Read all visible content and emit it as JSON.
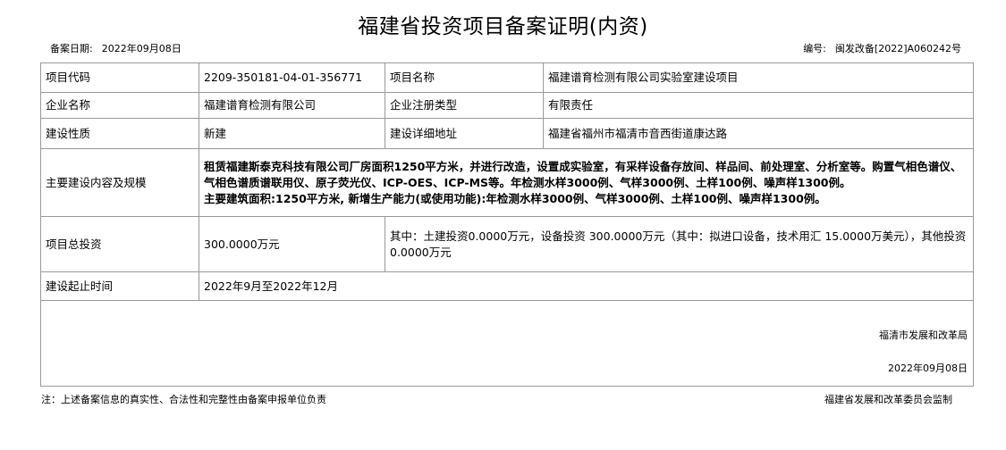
{
  "doc": {
    "title": "福建省投资项目备案证明(内资)",
    "filing_date_label": "备案日期:",
    "filing_date": "2022年09月08日",
    "number_label": "编号:",
    "number": "闽发改备[2022]A060242号"
  },
  "rows": {
    "project_code_label": "项目代码",
    "project_code": "2209-350181-04-01-356771",
    "project_name_label": "项目名称",
    "project_name": "福建谱育检测有限公司实验室建设项目",
    "company_label": "企业名称",
    "company": "福建谱育检测有限公司",
    "reg_type_label": "企业注册类型",
    "reg_type": "有限责任",
    "nature_label": "建设性质",
    "nature": "新建",
    "address_label": "建设详细地址",
    "address": "福建省福州市福清市音西街道康达路",
    "content_label": "主要建设内容及规模",
    "content_p1": "租赁福建斯泰克科技有限公司厂房面积1250平方米，并进行改造，设置成实验室，有采样设备存放间、样品间、前处理室、分析室等。购置气相色谱仪、气相色谱质谱联用仪、原子荧光仪、ICP-OES、ICP-MS等。年检测水样3000例、气样3000例、土样100例、噪声样1300例。",
    "content_p2": "主要建筑面积:1250平方米, 新增生产能力(或使用功能):年检测水样3000例、气样3000例、土样100例、噪声样1300例。",
    "investment_label": "项目总投资",
    "investment": "300.0000万元",
    "investment_detail": "其中：土建投资0.0000万元，设备投资 300.0000万元（其中：拟进口设备，技术用汇 15.0000万美元），其他投资 0.0000万元",
    "period_label": "建设起止时间",
    "period": "2022年9月至2022年12月"
  },
  "sign": {
    "org": "福清市发展和改革局",
    "date": "2022年09月08日"
  },
  "footer": {
    "note": "注：上述备案信息的真实性、合法性和完整性由备案申报单位负责",
    "supervisor": "福建省发展和改革委员会监制"
  }
}
